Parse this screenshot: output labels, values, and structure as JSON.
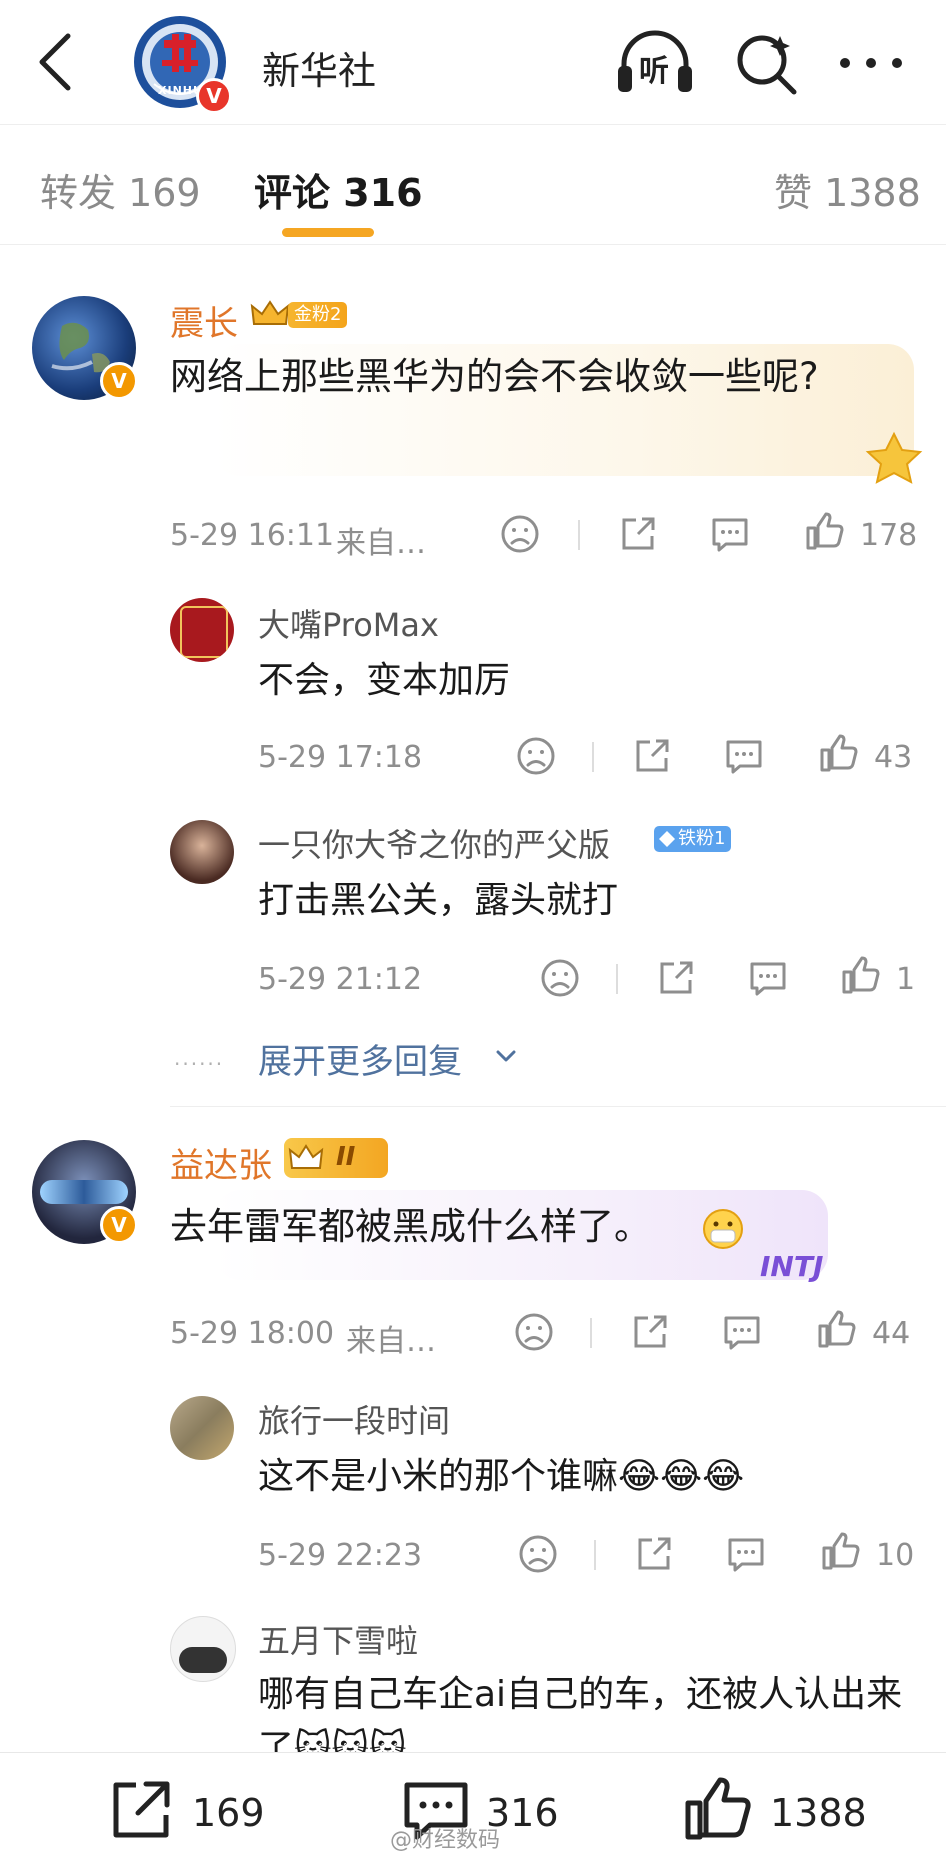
{
  "header": {
    "account_name": "新华社",
    "logo_text": "XINHUA",
    "listen_label": "听"
  },
  "tabs": {
    "repost": "转发 169",
    "comments": "评论 316",
    "likes": "赞 1388"
  },
  "comments": [
    {
      "user": "震长",
      "fan_badge": "金粉2",
      "text": "网络上那些黑华为的会不会收敛一些呢?",
      "time": "5-29 16:11",
      "source": "来自…",
      "likes": "178",
      "replies": [
        {
          "user": "大嘴ProMax",
          "text": "不会，变本加厉",
          "time": "5-29 17:18",
          "likes": "43"
        },
        {
          "user": "一只你大爷之你的严父版",
          "fan_badge": "铁粉1",
          "text": "打击黑公关，露头就打",
          "time": "5-29 21:12",
          "likes": "1"
        }
      ],
      "expand_label": "展开更多回复"
    },
    {
      "user": "益达张",
      "level_badge": "II",
      "text": "去年雷军都被黑成什么样了。",
      "bubble_tag": "INTJ",
      "time": "5-29 18:00",
      "source": "来自…",
      "likes": "44",
      "replies": [
        {
          "user": "旅行一段时间",
          "text": "这不是小米的那个谁嘛😂😂😂",
          "time": "5-29 22:23",
          "likes": "10"
        },
        {
          "user": "五月下雪啦",
          "text": "哪有自己车企ai自己的车，还被人认出来了🐱🐱🐱"
        }
      ]
    }
  ],
  "bottom_bar": {
    "repost_count": "169",
    "comment_count": "316",
    "like_count": "1388"
  },
  "watermark": "@财经数码",
  "colors": {
    "accent": "#f5a623",
    "username_orange": "#e0762a",
    "expand_blue": "#50729e",
    "vip_badge": "#f39800"
  }
}
